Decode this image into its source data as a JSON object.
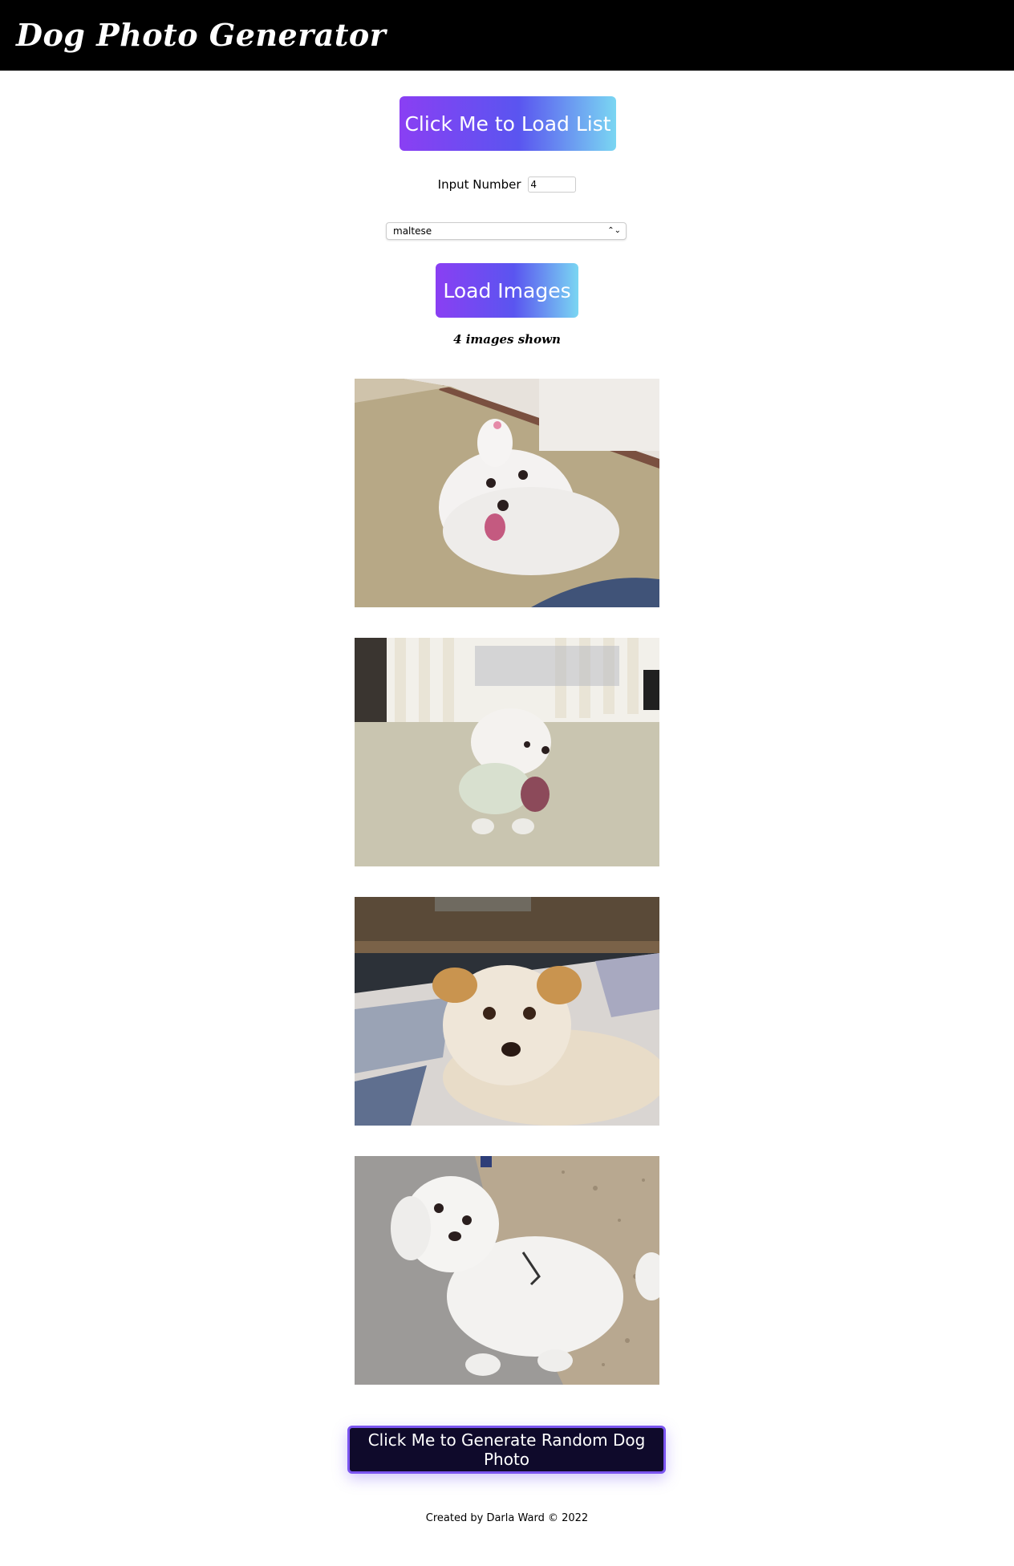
{
  "header": {
    "title": "Dog Photo Generator"
  },
  "controls": {
    "load_list_label": "Click Me to Load List",
    "number_label": "Input Number",
    "number_value": "4",
    "breed_selected": "maltese",
    "load_images_label": "Load Images"
  },
  "results": {
    "count_text": "4 images shown",
    "images": [
      "maltese dog photo",
      "maltese dog photo",
      "maltese dog photo",
      "maltese dog photo"
    ]
  },
  "random_button_label": "Click Me to Generate Random Dog Photo",
  "footer": {
    "text": "Created by Darla Ward © 2022"
  },
  "colors": {
    "header_bg": "#000000",
    "gradient_start": "#8a3ff3",
    "gradient_end": "#7ad6f2",
    "random_button_bg": "#0f0a2b"
  }
}
